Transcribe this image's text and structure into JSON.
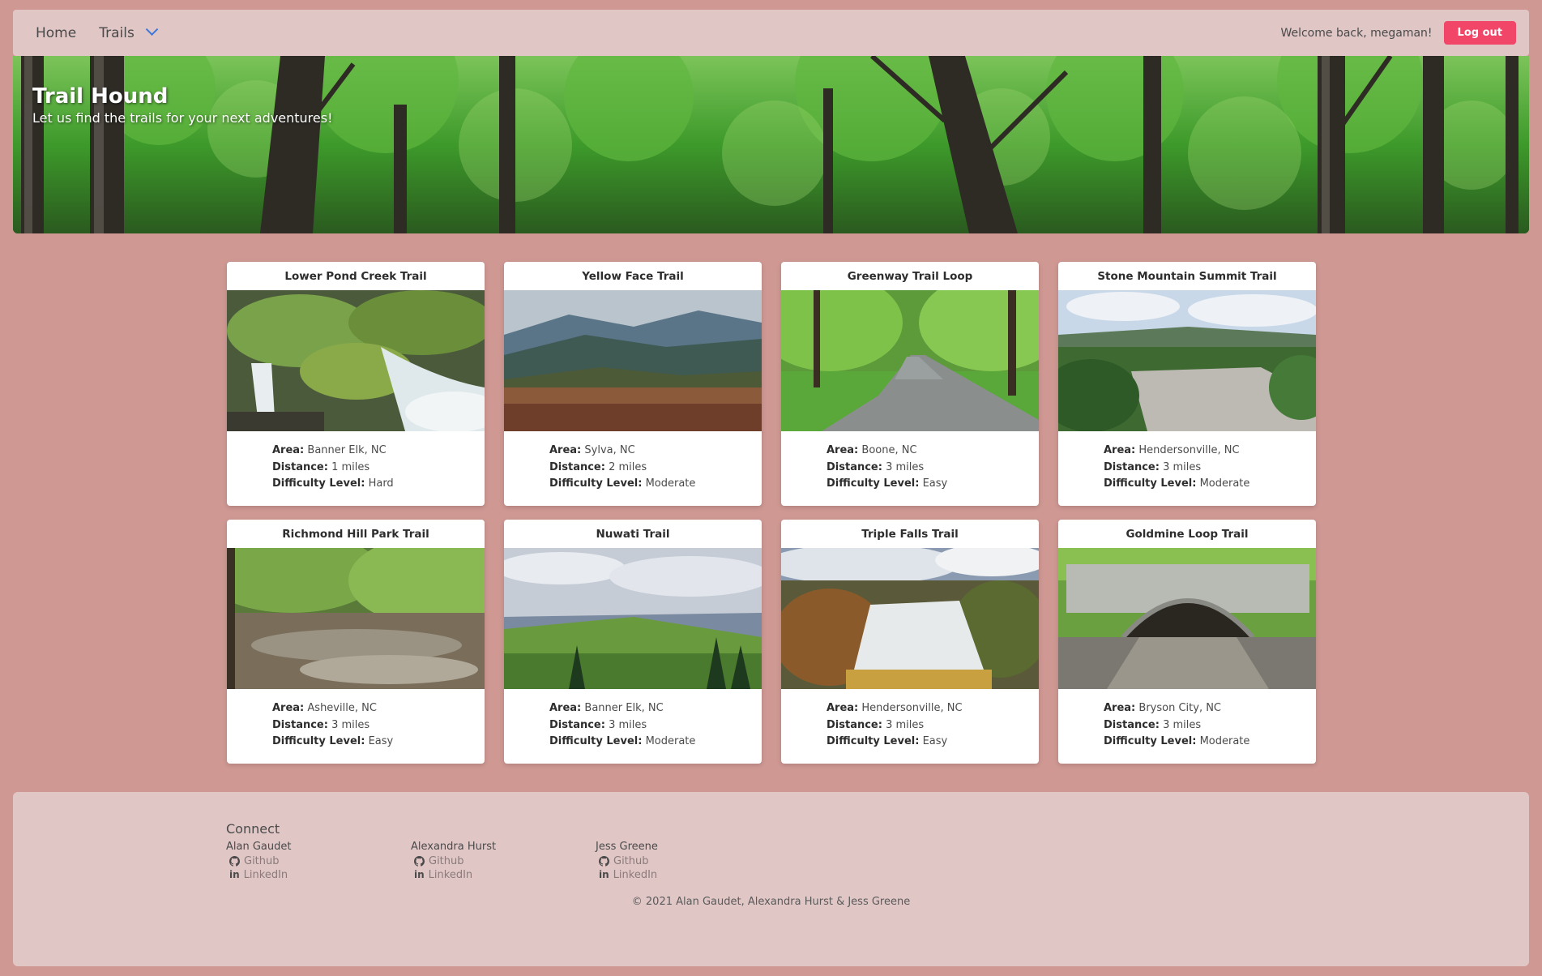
{
  "nav": {
    "home": "Home",
    "trails": "Trails",
    "welcome": "Welcome back, megaman!",
    "logout": "Log out"
  },
  "hero": {
    "title": "Trail Hound",
    "subtitle": "Let us find the trails for your next adventures!"
  },
  "labels": {
    "area": "Area:",
    "distance": "Distance:",
    "difficulty": "Difficulty Level:"
  },
  "trails": [
    {
      "name": "Lower Pond Creek Trail",
      "area": "Banner Elk, NC",
      "distance": "1 miles",
      "difficulty": "Hard"
    },
    {
      "name": "Yellow Face Trail",
      "area": "Sylva, NC",
      "distance": "2 miles",
      "difficulty": "Moderate"
    },
    {
      "name": "Greenway Trail Loop",
      "area": "Boone, NC",
      "distance": "3 miles",
      "difficulty": "Easy"
    },
    {
      "name": "Stone Mountain Summit Trail",
      "area": "Hendersonville, NC",
      "distance": "3 miles",
      "difficulty": "Moderate"
    },
    {
      "name": "Richmond Hill Park Trail",
      "area": "Asheville, NC",
      "distance": "3 miles",
      "difficulty": "Easy"
    },
    {
      "name": "Nuwati Trail",
      "area": "Banner Elk, NC",
      "distance": "3 miles",
      "difficulty": "Moderate"
    },
    {
      "name": "Triple Falls Trail",
      "area": "Hendersonville, NC",
      "distance": "3 miles",
      "difficulty": "Easy"
    },
    {
      "name": "Goldmine Loop Trail",
      "area": "Bryson City, NC",
      "distance": "3 miles",
      "difficulty": "Moderate"
    }
  ],
  "footer": {
    "connect": "Connect",
    "people": [
      {
        "name": "Alan Gaudet",
        "github": "Github",
        "linkedin": "LinkedIn"
      },
      {
        "name": "Alexandra Hurst",
        "github": "Github",
        "linkedin": "LinkedIn"
      },
      {
        "name": "Jess Greene",
        "github": "Github",
        "linkedin": "LinkedIn"
      }
    ],
    "copyright": "© 2021 Alan Gaudet, Alexandra Hurst & Jess Greene"
  },
  "colors": {
    "page_bg": "#cf9893",
    "panel_bg": "#e1c6c6",
    "logout_button": "#f14668",
    "chevron": "#3e78d8"
  }
}
